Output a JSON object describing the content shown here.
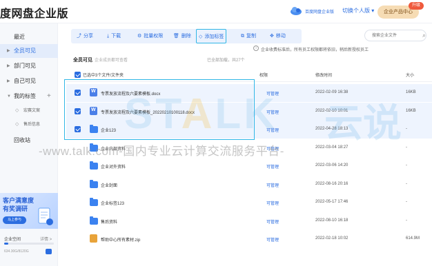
{
  "header": {
    "app_title": "度网盘企业版",
    "edition_label": "百度网盘企业版",
    "switch_user": "切换个人版 ▾",
    "product_center": "企业产品中心",
    "upgrade_badge": "升级"
  },
  "sidebar": {
    "items": [
      {
        "label": "最近"
      },
      {
        "label": "全员可见"
      },
      {
        "label": "部门可见"
      },
      {
        "label": "自己可见"
      },
      {
        "label": "我的标签"
      }
    ],
    "tags": [
      {
        "label": "宏赛文案"
      },
      {
        "label": "售后信息"
      }
    ],
    "recycle": "回收站",
    "banner": {
      "line1": "客户满意度",
      "line2": "有奖调研",
      "button": "马上参与"
    },
    "storage": {
      "title": "企业空间",
      "detail": "详情 >",
      "usage_text": "634.30G/8120G",
      "used_fraction": 0.08
    }
  },
  "toolbar": {
    "share": "分享",
    "download": "下载",
    "batch_permission": "批量权限",
    "delete": "删除",
    "add_tag": "添加标签",
    "copy": "复制",
    "move": "移动"
  },
  "search": {
    "placeholder": "搜索企业文件"
  },
  "notice": {
    "text": "企业收费标准后，所有员工权限都将依旧，稍后新授权员工"
  },
  "breadcrumb": {
    "current": "全员可见",
    "sub": "企业成员都可查看"
  },
  "loaded_count": "已全部加载，共27个",
  "table": {
    "header_name": "已选中3个文件/文件夹",
    "header_perm": "权限",
    "header_time": "修改时间",
    "header_size": "大小",
    "rows": [
      {
        "name": "专票发放流程及六要素模板.docx",
        "perm": "可管理",
        "time": "2022-02-09 16:38",
        "size": "16KB",
        "type": "doc",
        "selected": true
      },
      {
        "name": "专票发放流程及六要素模板_20220210100118.docx",
        "perm": "可管理",
        "time": "2022-02-10 10:01",
        "size": "16KB",
        "type": "doc",
        "selected": true
      },
      {
        "name": "企业123",
        "perm": "可管理",
        "time": "2022-04-28 18:13",
        "size": "-",
        "type": "folder",
        "selected": true
      },
      {
        "name": "企业内部资料",
        "perm": "可管理",
        "time": "2022-03-04 18:27",
        "size": "-",
        "type": "folder",
        "selected": false
      },
      {
        "name": "企业对外资料",
        "perm": "可管理",
        "time": "2022-03-06 14:20",
        "size": "-",
        "type": "folder",
        "selected": false
      },
      {
        "name": "企业封面",
        "perm": "可管理",
        "time": "2022-08-16 20:16",
        "size": "-",
        "type": "folder",
        "selected": false
      },
      {
        "name": "企业标签123",
        "perm": "可管理",
        "time": "2022-05-17 17:46",
        "size": "-",
        "type": "folder",
        "selected": false
      },
      {
        "name": "售后资料",
        "perm": "可管理",
        "time": "2022-08-10 16:18",
        "size": "-",
        "type": "folder",
        "selected": false
      },
      {
        "name": "帮助中心所有素材.zip",
        "perm": "可管理",
        "time": "2022-02-18 10:02",
        "size": "614.9M",
        "type": "zip",
        "selected": false
      }
    ]
  },
  "watermark": {
    "logo_pre": "ST",
    "logo_mid": "A",
    "logo_post": "LK",
    "cn": "云说",
    "url": "-www.talk.com-国内专业云计算交流服务平台-"
  }
}
